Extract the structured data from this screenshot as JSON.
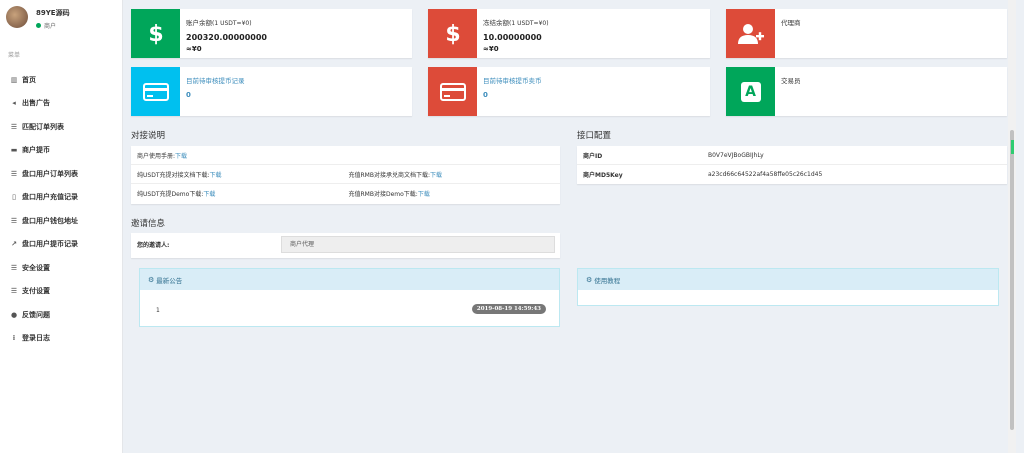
{
  "user": {
    "name": "89YE源码",
    "role": "商户"
  },
  "menu": {
    "header": "菜单",
    "items": [
      {
        "label": "首页",
        "icon": "bar-chart-icon",
        "glyph": "▥"
      },
      {
        "label": "出售广告",
        "icon": "megaphone-icon",
        "glyph": "◂"
      },
      {
        "label": "匹配订单列表",
        "icon": "list-icon",
        "glyph": "☰"
      },
      {
        "label": "商户提币",
        "icon": "card-icon",
        "glyph": "▬"
      },
      {
        "label": "盘口用户订单列表",
        "icon": "list-icon",
        "glyph": "☰"
      },
      {
        "label": "盘口用户充值记录",
        "icon": "file-icon",
        "glyph": "▯"
      },
      {
        "label": "盘口用户钱包地址",
        "icon": "list-icon",
        "glyph": "☰"
      },
      {
        "label": "盘口用户提币记录",
        "icon": "external-link-icon",
        "glyph": "↗"
      },
      {
        "label": "安全设置",
        "icon": "list-icon",
        "glyph": "☰"
      },
      {
        "label": "支付设置",
        "icon": "list-icon",
        "glyph": "☰"
      },
      {
        "label": "反馈问题",
        "icon": "comment-icon",
        "glyph": "●"
      },
      {
        "label": "登录日志",
        "icon": "log-icon",
        "glyph": "⁝"
      }
    ]
  },
  "stats": {
    "balance": {
      "label": "账户余额",
      "note": "(1 USDT=¥0)",
      "value": "200320.00000000",
      "cny": "≈¥0",
      "color": "#00a65a"
    },
    "frozen": {
      "label": "冻结余额",
      "note": "(1 USDT=¥0)",
      "value": "10.00000000",
      "cny": "≈¥0",
      "color": "#dd4b39"
    },
    "agent": {
      "label": "代理商",
      "color": "#dd4b39"
    },
    "pending_withdraw": {
      "label": "目前待审核提币记录",
      "value": "0",
      "color": "#00c0ef"
    },
    "pending_sell": {
      "label": "目前待审核提币卖币",
      "value": "0",
      "color": "#dd4b39"
    },
    "trader": {
      "label": "交易员",
      "color": "#00a65a",
      "glyph": "A"
    }
  },
  "docking": {
    "title": "对接说明",
    "manual_label": "商户使用手册:",
    "download": "下载",
    "rows": [
      {
        "left": "纯USDT充提对接文档下载:",
        "right": "充值RMB对接承兑商文档下载:"
      },
      {
        "left": "纯USDT充提Demo下载:",
        "right": "充值RMB对接Demo下载:"
      }
    ]
  },
  "api": {
    "title": "接口配置",
    "id_label": "商户ID",
    "id_value": "B0V7eVJBoGBIJhLy",
    "key_label": "商户MD5Key",
    "key_value": "a23cd66c64522af4a58ffe05c26c1d45"
  },
  "invite": {
    "title": "邀请信息",
    "label": "您的邀请人:",
    "value": "商户代理"
  },
  "notice": {
    "title": "最新公告",
    "number": "1",
    "time": "2019-08-19 14:59:43"
  },
  "tutorial": {
    "title": "使用教程"
  }
}
